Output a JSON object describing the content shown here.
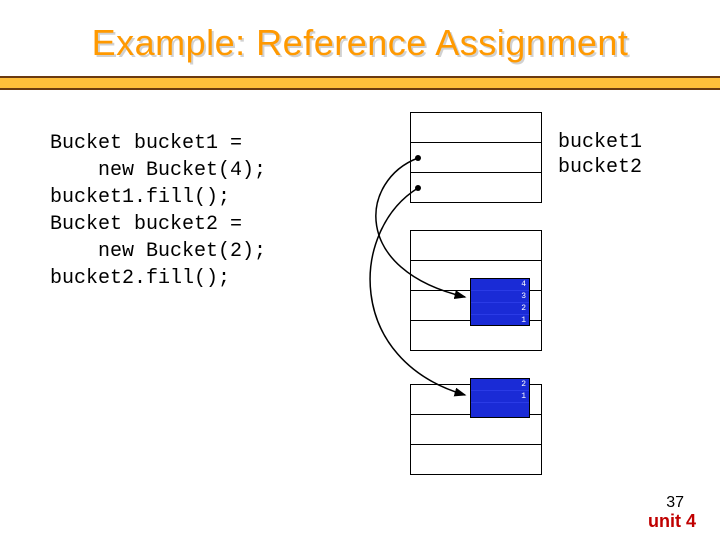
{
  "title": "Example: Reference Assignment",
  "code": {
    "l1": "Bucket bucket1 =",
    "l2": "    new Bucket(4);",
    "l3": "bucket1.fill();",
    "l4": "Bucket bucket2 =",
    "l5": "    new Bucket(2);",
    "l6": "bucket2.fill();"
  },
  "labels": {
    "b1": "bucket1",
    "b2": "bucket2"
  },
  "bucket1_rows": [
    "4",
    "3",
    "2",
    "1"
  ],
  "bucket2_rows": [
    "2",
    "1",
    ""
  ],
  "footer": {
    "num": "37",
    "unit": "unit 4"
  }
}
